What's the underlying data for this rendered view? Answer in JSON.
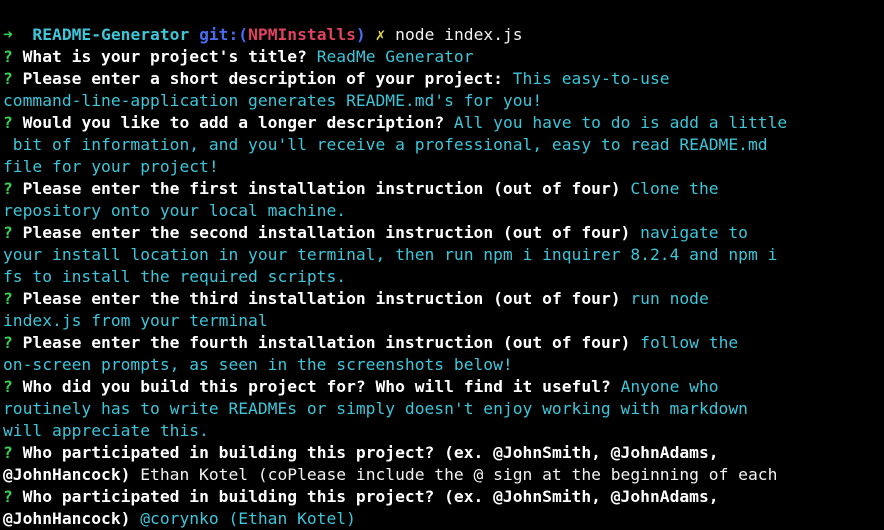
{
  "shell": {
    "arrow": "➜",
    "dir": "README-Generator",
    "git_label": "git:(",
    "branch": "NPMInstalls",
    "git_close": ")",
    "dirty": "✗",
    "command": "node index.js"
  },
  "qmark": "?",
  "lines": [
    {
      "q": true,
      "prompt": "What is your project's title?",
      "ans": " ReadMe Generator"
    },
    {
      "q": true,
      "prompt": "Please enter a short description of your project:",
      "ans": " This easy-to-use"
    },
    {
      "q": false,
      "ans": "command-line-application generates README.md's for you!"
    },
    {
      "q": true,
      "prompt": "Would you like to add a longer description?",
      "ans": " All you have to do is add a little"
    },
    {
      "q": false,
      "ans": " bit of information, and you'll receive a professional, easy to read README.md"
    },
    {
      "q": false,
      "ans": "file for your project!"
    },
    {
      "q": true,
      "prompt": "Please enter the first installation instruction (out of four)",
      "ans": " Clone the"
    },
    {
      "q": false,
      "ans": "repository onto your local machine."
    },
    {
      "q": true,
      "prompt": "Please enter the second installation instruction (out of four)",
      "ans": " navigate to"
    },
    {
      "q": false,
      "ans": "your install location in your terminal, then run npm i inquirer 8.2.4 and npm i"
    },
    {
      "q": false,
      "ans": "fs to install the required scripts."
    },
    {
      "q": true,
      "prompt": "Please enter the third installation instruction (out of four)",
      "ans": " run node"
    },
    {
      "q": false,
      "ans": "index.js from your terminal"
    },
    {
      "q": true,
      "prompt": "Please enter the fourth installation instruction (out of four)",
      "ans": " follow the"
    },
    {
      "q": false,
      "ans": "on-screen prompts, as seen in the screenshots below!"
    },
    {
      "q": true,
      "prompt": "Who did you build this project for? Who will find it useful?",
      "ans": " Anyone who"
    },
    {
      "q": false,
      "ans": "routinely has to write READMEs or simply doesn't enjoy working with markdown"
    },
    {
      "q": false,
      "ans": "will appreciate this."
    },
    {
      "q": true,
      "prompt": "Who participated in building this project? (ex. @JohnSmith, @JohnAdams,",
      "ans": ""
    },
    {
      "q": false,
      "prompt": "@JohnHancock)",
      "plain": " Ethan Kotel (coPlease include the @ sign at the beginning of each"
    },
    {
      "q": true,
      "prompt": "Who participated in building this project? (ex. @JohnSmith, @JohnAdams,",
      "ans": ""
    },
    {
      "q": false,
      "prompt": "@JohnHancock)",
      "ans": " @corynko (Ethan Kotel)"
    }
  ]
}
